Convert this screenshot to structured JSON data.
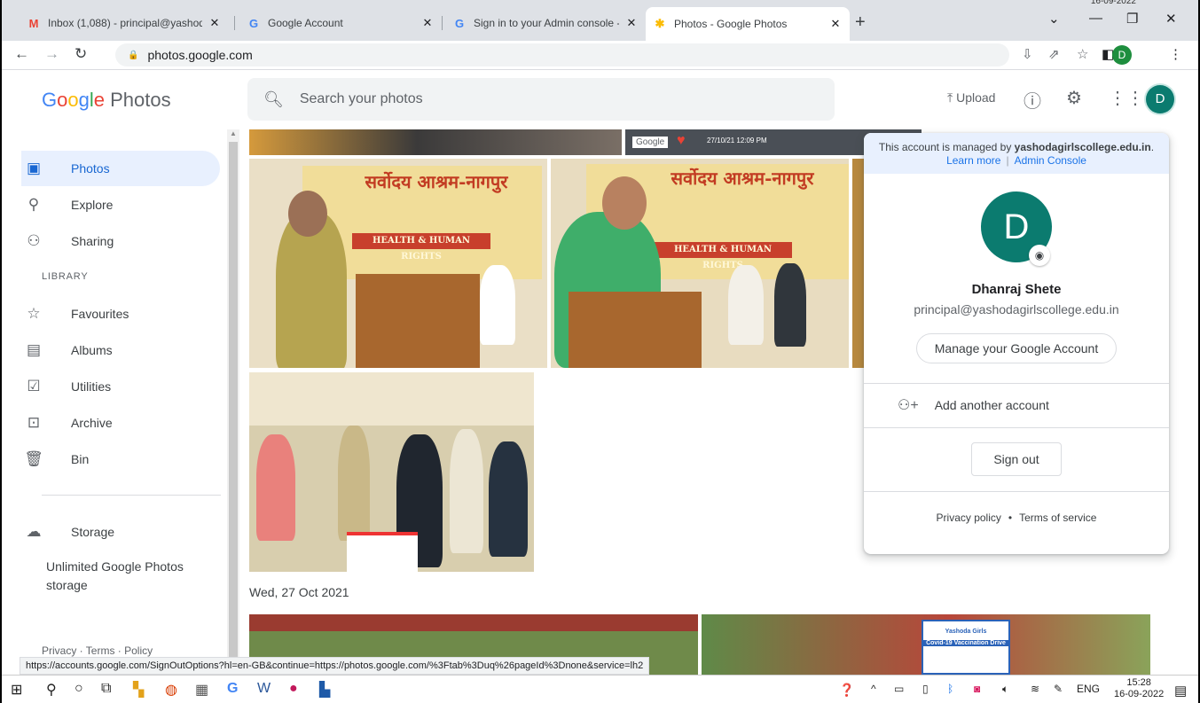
{
  "browser": {
    "tabs": [
      {
        "title": "Inbox (1,088) - principal@yashod",
        "favicon": "gmail-icon",
        "active": false
      },
      {
        "title": "Google Account",
        "favicon": "google-icon",
        "active": false
      },
      {
        "title": "Sign in to your Admin console - (",
        "favicon": "google-icon",
        "active": false
      },
      {
        "title": "Photos - Google Photos",
        "favicon": "photos-icon",
        "active": true
      }
    ],
    "url": "photos.google.com",
    "profile_initial": "D",
    "clock_peek": "16-09-2022"
  },
  "app": {
    "logo_parts": [
      "G",
      "o",
      "o",
      "g",
      "l",
      "e"
    ],
    "logo_suffix": " Photos",
    "search_placeholder": "Search your photos",
    "upload_label": "Upload",
    "avatar_initial": "D"
  },
  "sidebar": {
    "items": [
      {
        "label": "Photos",
        "icon": "photo-icon",
        "active": true
      },
      {
        "label": "Explore",
        "icon": "search-icon"
      },
      {
        "label": "Sharing",
        "icon": "people-icon"
      }
    ],
    "library_heading": "LIBRARY",
    "library_items": [
      {
        "label": "Favourites",
        "icon": "star-icon"
      },
      {
        "label": "Albums",
        "icon": "album-icon"
      },
      {
        "label": "Utilities",
        "icon": "check-box-icon"
      },
      {
        "label": "Archive",
        "icon": "archive-icon"
      },
      {
        "label": "Bin",
        "icon": "trash-icon"
      }
    ],
    "storage_label": "Storage",
    "storage_note": "Unlimited Google Photos storage",
    "footer": "Privacy · Terms · Policy"
  },
  "photos": {
    "map_overlay_brand": "Google",
    "map_overlay_time": "27/10/21 12:09 PM",
    "banner_text": "सर्वोदय आश्रम-नागपुर",
    "banner_sub": "HEALTH & HUMAN RIGHTS",
    "date_label": "Wed, 27 Oct 2021",
    "vaccination_sign_title": "Covid-19 Vaccination Drive",
    "vaccination_sign_org": "Yashoda Girls"
  },
  "account_popup": {
    "managed_text": "This account is managed by ",
    "managed_domain": "yashodagirlscollege.edu.in",
    "learn_more": "Learn more",
    "admin_console": "Admin Console",
    "initial": "D",
    "name": "Dhanraj Shete",
    "email": "principal@yashodagirlscollege.edu.in",
    "manage_button": "Manage your Google Account",
    "add_account": "Add another account",
    "sign_out": "Sign out",
    "privacy": "Privacy policy",
    "terms": "Terms of service"
  },
  "status_url": "https://accounts.google.com/SignOutOptions?hl=en-GB&continue=https://photos.google.com/%3Ftab%3Duq%26pageId%3Dnone&service=lh2",
  "taskbar": {
    "lang": "ENG",
    "time": "15:28",
    "date": "16-09-2022"
  },
  "colors": {
    "accent": "#1a73e8",
    "active_nav_bg": "#e8f0fe",
    "avatar": "#0b7b6f"
  }
}
